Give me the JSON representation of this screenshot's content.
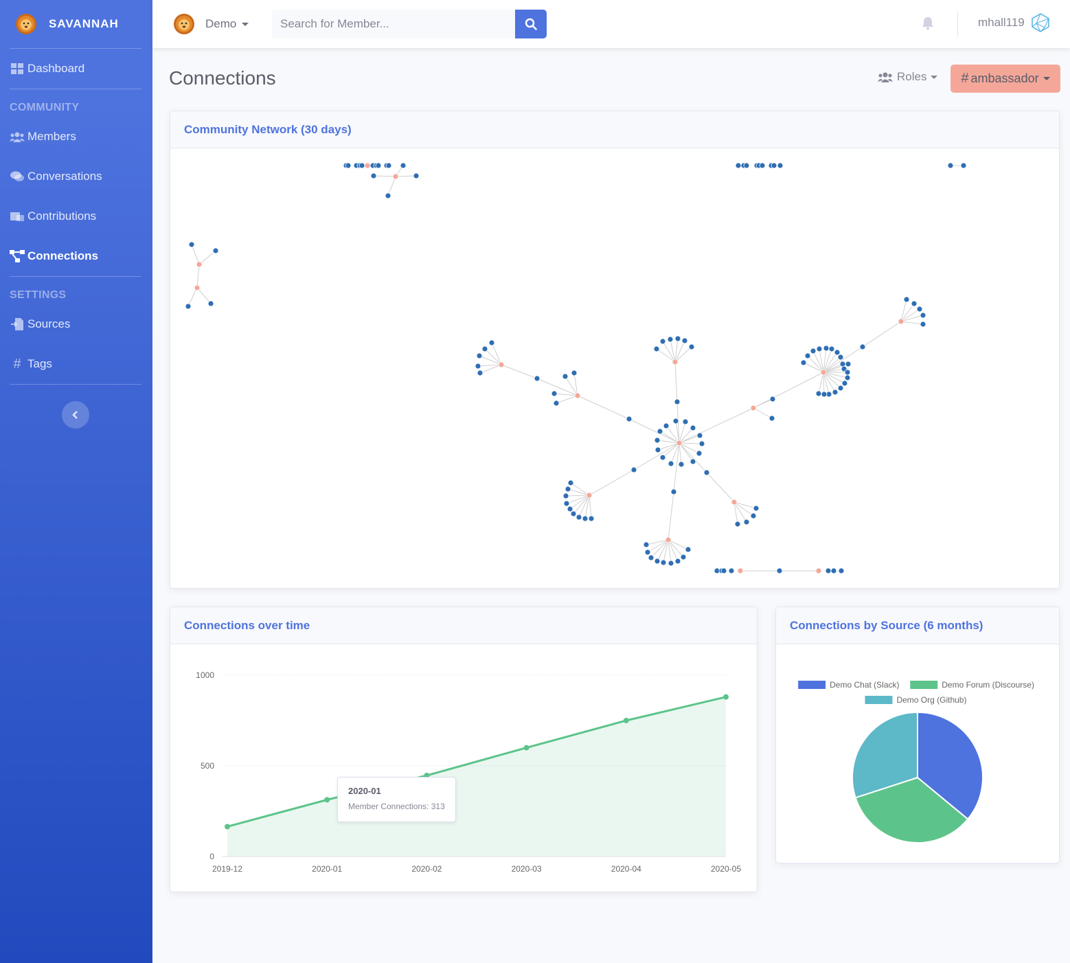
{
  "brand": {
    "name": "SAVANNAH"
  },
  "sidebar": {
    "dashboard": "Dashboard",
    "heading_community": "COMMUNITY",
    "members": "Members",
    "conversations": "Conversations",
    "contributions": "Contributions",
    "connections": "Connections",
    "heading_settings": "SETTINGS",
    "sources": "Sources",
    "tags": "Tags"
  },
  "topbar": {
    "project": "Demo",
    "search_placeholder": "Search for Member...",
    "username": "mhall119"
  },
  "page": {
    "title": "Connections",
    "roles_label": "Roles",
    "tag_label": "ambassador"
  },
  "network_card": {
    "title": "Community Network (30 days)"
  },
  "line_card": {
    "title": "Connections over time"
  },
  "pie_card": {
    "title": "Connections by Source (6 months)"
  },
  "colors": {
    "primary": "#4e73df",
    "success": "#5cc48a",
    "info": "#5db8c8",
    "node": "#2f6eb3",
    "hub": "#f4a799"
  },
  "tooltip": {
    "title": "2020-01",
    "label": "Member Connections: 313"
  },
  "chart_data": [
    {
      "type": "line",
      "categories": [
        "2019-12",
        "2020-01",
        "2020-02",
        "2020-03",
        "2020-04",
        "2020-05"
      ],
      "series": [
        {
          "name": "Member Connections",
          "values": [
            165,
            313,
            447,
            600,
            750,
            880
          ]
        }
      ],
      "ylim": [
        0,
        1000
      ],
      "yticks": [
        0,
        500,
        1000
      ],
      "fill": true,
      "grid": true
    },
    {
      "type": "pie",
      "categories": [
        "Demo Chat (Slack)",
        "Demo Forum (Discourse)",
        "Demo Org (Github)"
      ],
      "values": [
        36,
        34,
        30
      ],
      "legend": "top"
    }
  ]
}
